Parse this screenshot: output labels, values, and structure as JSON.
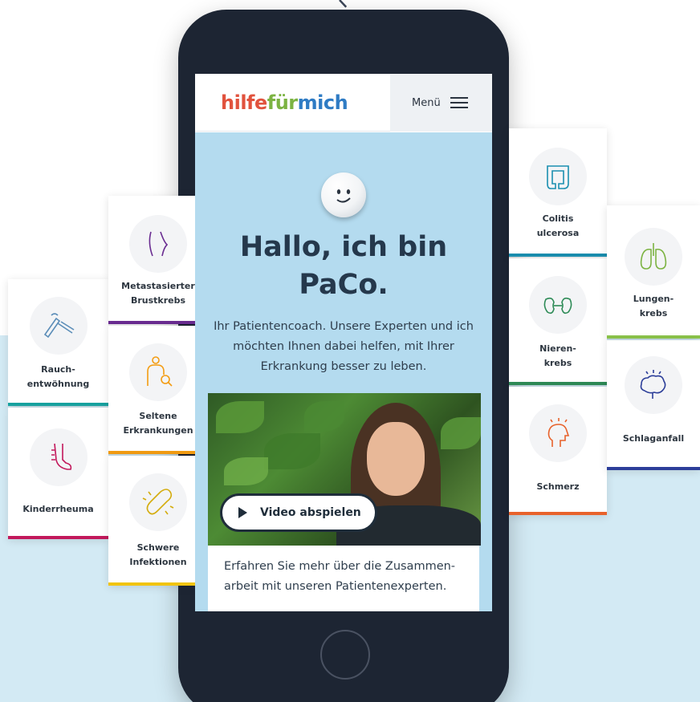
{
  "header": {
    "logo_parts": [
      "hilfe",
      "für",
      "mich"
    ],
    "menu_label": "Menü"
  },
  "hero": {
    "title": "Hallo, ich bin PaCo.",
    "description": "Ihr Patientencoach. Unsere Experten und ich möchten Ihnen dabei helfen, mit Ihrer Erkrankung besser zu leben.",
    "video_button": "Video abspielen",
    "more_text": "Erfahren Sie mehr über die Zusammen-arbeit mit unseren Patientenexperten."
  },
  "cards": [
    {
      "id": "rauch",
      "lines": [
        "Rauch-",
        "entwöhnung"
      ],
      "color": "#17a3a1",
      "icon": "cigarette-icon"
    },
    {
      "id": "kinder",
      "lines": [
        "Kinderrheuma"
      ],
      "color": "#c2185b",
      "icon": "foot-icon"
    },
    {
      "id": "brust",
      "lines": [
        "Metastasierter",
        "Brustkrebs"
      ],
      "color": "#6a2c91",
      "icon": "breast-icon"
    },
    {
      "id": "seltene",
      "lines": [
        "Seltene",
        "Erkrankungen"
      ],
      "color": "#f39c12",
      "icon": "body-search-icon"
    },
    {
      "id": "infekt",
      "lines": [
        "Schwere",
        "Infektionen"
      ],
      "color": "#f1c40f",
      "icon": "bacteria-icon"
    },
    {
      "id": "colitis",
      "lines": [
        "Colitis",
        "ulcerosa"
      ],
      "color": "#1b8fb0",
      "icon": "intestine-icon"
    },
    {
      "id": "nieren",
      "lines": [
        "Nieren-",
        "krebs"
      ],
      "color": "#2e8b57",
      "icon": "kidney-icon"
    },
    {
      "id": "schmerz",
      "lines": [
        "Schmerz"
      ],
      "color": "#e8622b",
      "icon": "head-pain-icon"
    },
    {
      "id": "lungen",
      "lines": [
        "Lungen-",
        "krebs"
      ],
      "color": "#8bc34a",
      "icon": "lungs-icon"
    },
    {
      "id": "schlag",
      "lines": [
        "Schlaganfall"
      ],
      "color": "#2c3e99",
      "icon": "brain-icon"
    }
  ]
}
